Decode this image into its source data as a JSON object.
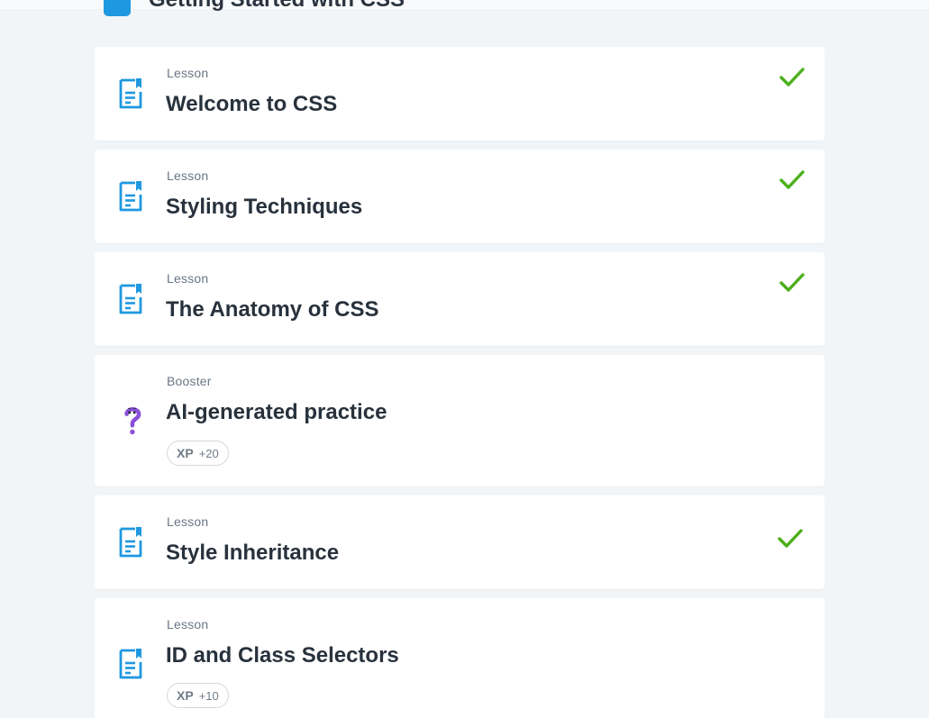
{
  "module": {
    "title": "Getting Started with CSS"
  },
  "items": [
    {
      "type": "Lesson",
      "title": "Welcome to CSS",
      "completed": true,
      "icon": "lesson-document-icon"
    },
    {
      "type": "Lesson",
      "title": "Styling Techniques",
      "completed": true,
      "icon": "lesson-document-icon"
    },
    {
      "type": "Lesson",
      "title": "The Anatomy of CSS",
      "completed": true,
      "icon": "lesson-document-icon"
    },
    {
      "type": "Booster",
      "title": "AI-generated practice",
      "completed": false,
      "icon": "question-mark-icon",
      "xp_label": "XP",
      "xp_value": "+20"
    },
    {
      "type": "Lesson",
      "title": "Style Inheritance",
      "completed": true,
      "icon": "lesson-document-icon"
    },
    {
      "type": "Lesson",
      "title": "ID and Class Selectors",
      "completed": false,
      "icon": "lesson-document-icon",
      "xp_label": "XP",
      "xp_value": "+10"
    }
  ],
  "colors": {
    "accent": "#1e98e0",
    "check": "#4caf1a",
    "booster": "#8b4fd8",
    "background": "#f2f5f7"
  }
}
